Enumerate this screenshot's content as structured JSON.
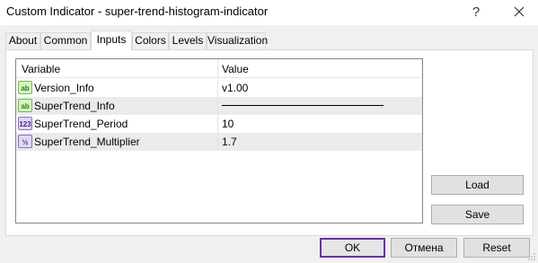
{
  "window": {
    "title": "Custom Indicator - super-trend-histogram-indicator"
  },
  "tabs": [
    {
      "label": "About"
    },
    {
      "label": "Common"
    },
    {
      "label": "Inputs"
    },
    {
      "label": "Colors"
    },
    {
      "label": "Levels"
    },
    {
      "label": "Visualization"
    }
  ],
  "active_tab": "Inputs",
  "grid": {
    "headers": {
      "variable": "Variable",
      "value": "Value"
    },
    "rows": [
      {
        "icon": "ab",
        "name": "Version_Info",
        "value": "v1.00"
      },
      {
        "icon": "ab",
        "name": "SuperTrend_Info",
        "value": ""
      },
      {
        "icon": "123",
        "name": "SuperTrend_Period",
        "value": "10"
      },
      {
        "icon": "½",
        "name": "SuperTrend_Multiplier",
        "value": "1.7"
      }
    ]
  },
  "side_buttons": {
    "load": "Load",
    "save": "Save"
  },
  "footer": {
    "ok": "OK",
    "cancel": "Отмена",
    "reset": "Reset"
  }
}
